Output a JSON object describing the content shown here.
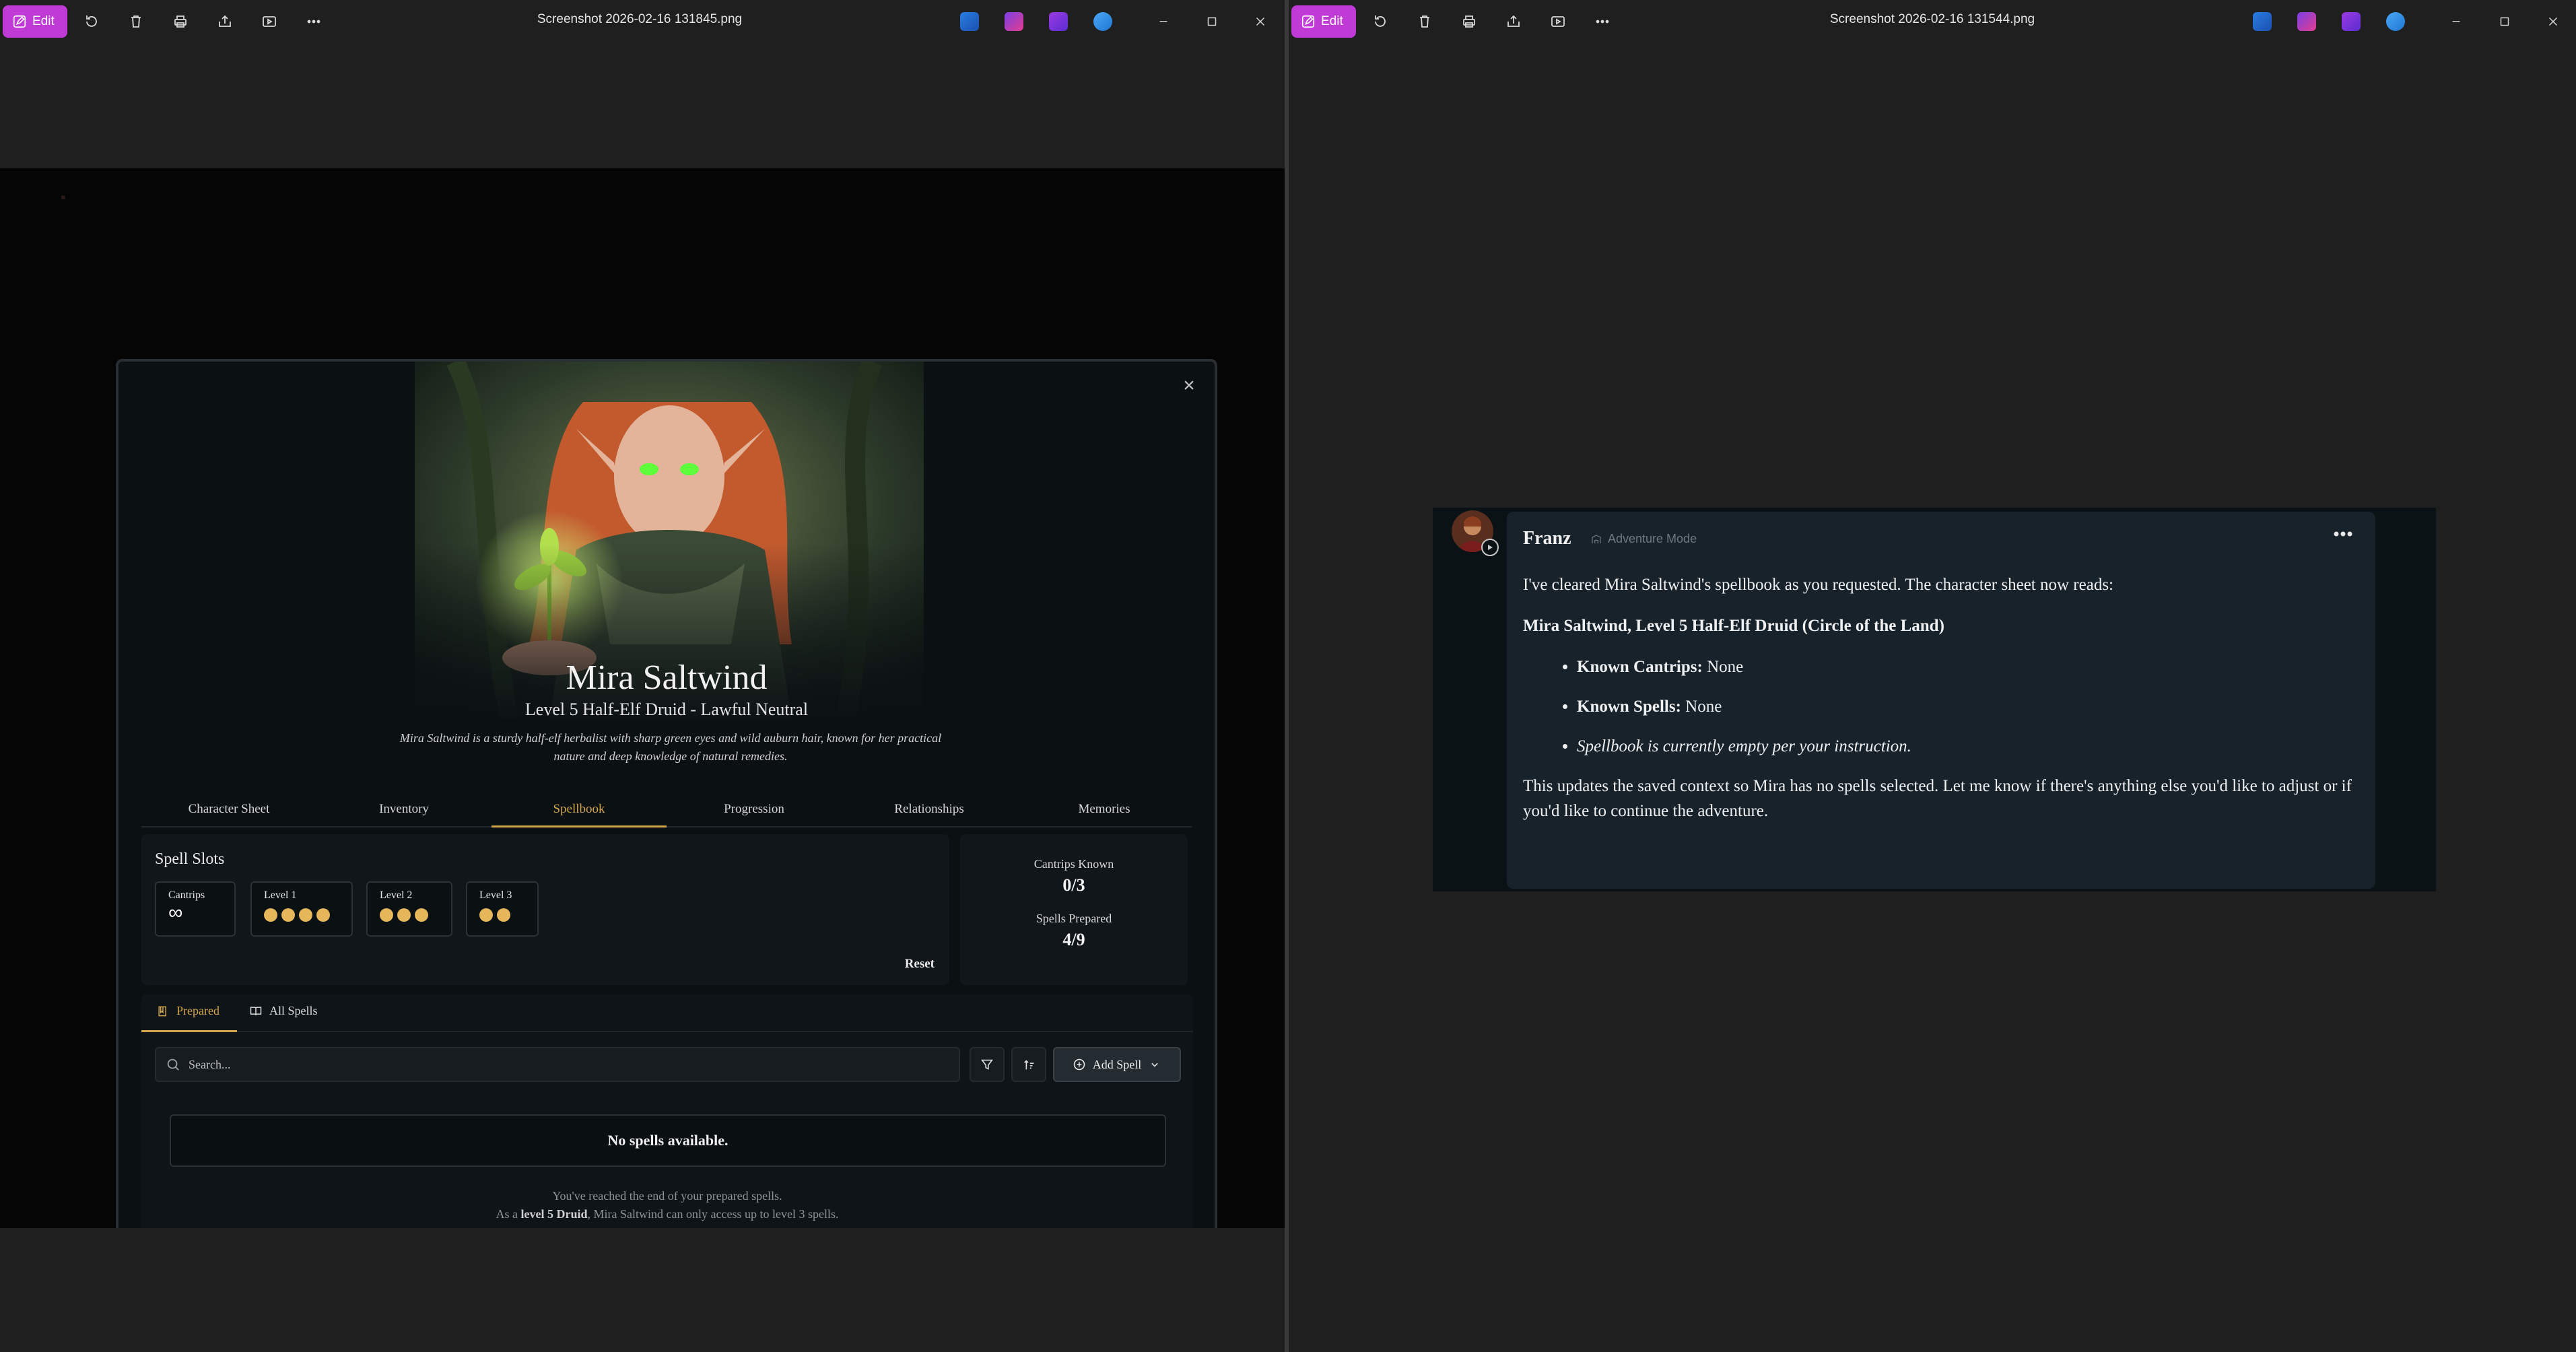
{
  "left_window": {
    "edit_label": "Edit",
    "title": "Screenshot 2026-02-16 131845.png"
  },
  "right_window": {
    "edit_label": "Edit",
    "title": "Screenshot 2026-02-16 131544.png"
  },
  "character": {
    "name": "Mira Saltwind",
    "subtitle": "Level 5 Half-Elf Druid - Lawful Neutral",
    "description": "Mira Saltwind is a sturdy half-elf herbalist with sharp green eyes and wild auburn hair, known for her practical nature and deep knowledge of natural remedies."
  },
  "tabs": [
    {
      "label": "Character Sheet"
    },
    {
      "label": "Inventory"
    },
    {
      "label": "Spellbook"
    },
    {
      "label": "Progression"
    },
    {
      "label": "Relationships"
    },
    {
      "label": "Memories"
    }
  ],
  "active_tab": "Spellbook",
  "spell_slots": {
    "title": "Spell Slots",
    "cantrips_label": "Cantrips",
    "cantrips_value": "∞",
    "levels": [
      {
        "label": "Level 1",
        "count": 4
      },
      {
        "label": "Level 2",
        "count": 3
      },
      {
        "label": "Level 3",
        "count": 2
      }
    ],
    "reset_label": "Reset"
  },
  "known": {
    "cantrips_label": "Cantrips Known",
    "cantrips_value": "0/3",
    "prepared_label": "Spells Prepared",
    "prepared_value": "4/9"
  },
  "spell_list": {
    "prepared_tab": "Prepared",
    "all_tab": "All Spells",
    "search_placeholder": "Search...",
    "add_spell_label": "Add Spell",
    "empty_text": "No spells available.",
    "end_line1": "You've reached the end of your prepared spells.",
    "end_line2_pre": "As a ",
    "end_line2_bold": "level 5 Druid",
    "end_line2_post": ", Mira Saltwind can only access up to level 3 spells."
  },
  "chat": {
    "name": "Franz",
    "mode": "Adventure Mode",
    "intro": "I've cleared Mira Saltwind's spellbook as you requested. The character sheet now reads:",
    "heading": "Mira Saltwind, Level 5 Half-Elf Druid (Circle of the Land)",
    "bullets": [
      {
        "bold": "Known Cantrips:",
        "text": " None"
      },
      {
        "bold": "Known Spells:",
        "text": " None"
      }
    ],
    "italic_bullet": "Spellbook is currently empty per your instruction.",
    "outro": "This updates the saved context so Mira has no spells selected. Let me know if there's anything else you'd like to adjust or if you'd like to continue the adventure."
  },
  "colors": {
    "accent_gold": "#d4a64a",
    "slot_dot": "#e5b75a",
    "edit_purple": "#c03bd6"
  }
}
